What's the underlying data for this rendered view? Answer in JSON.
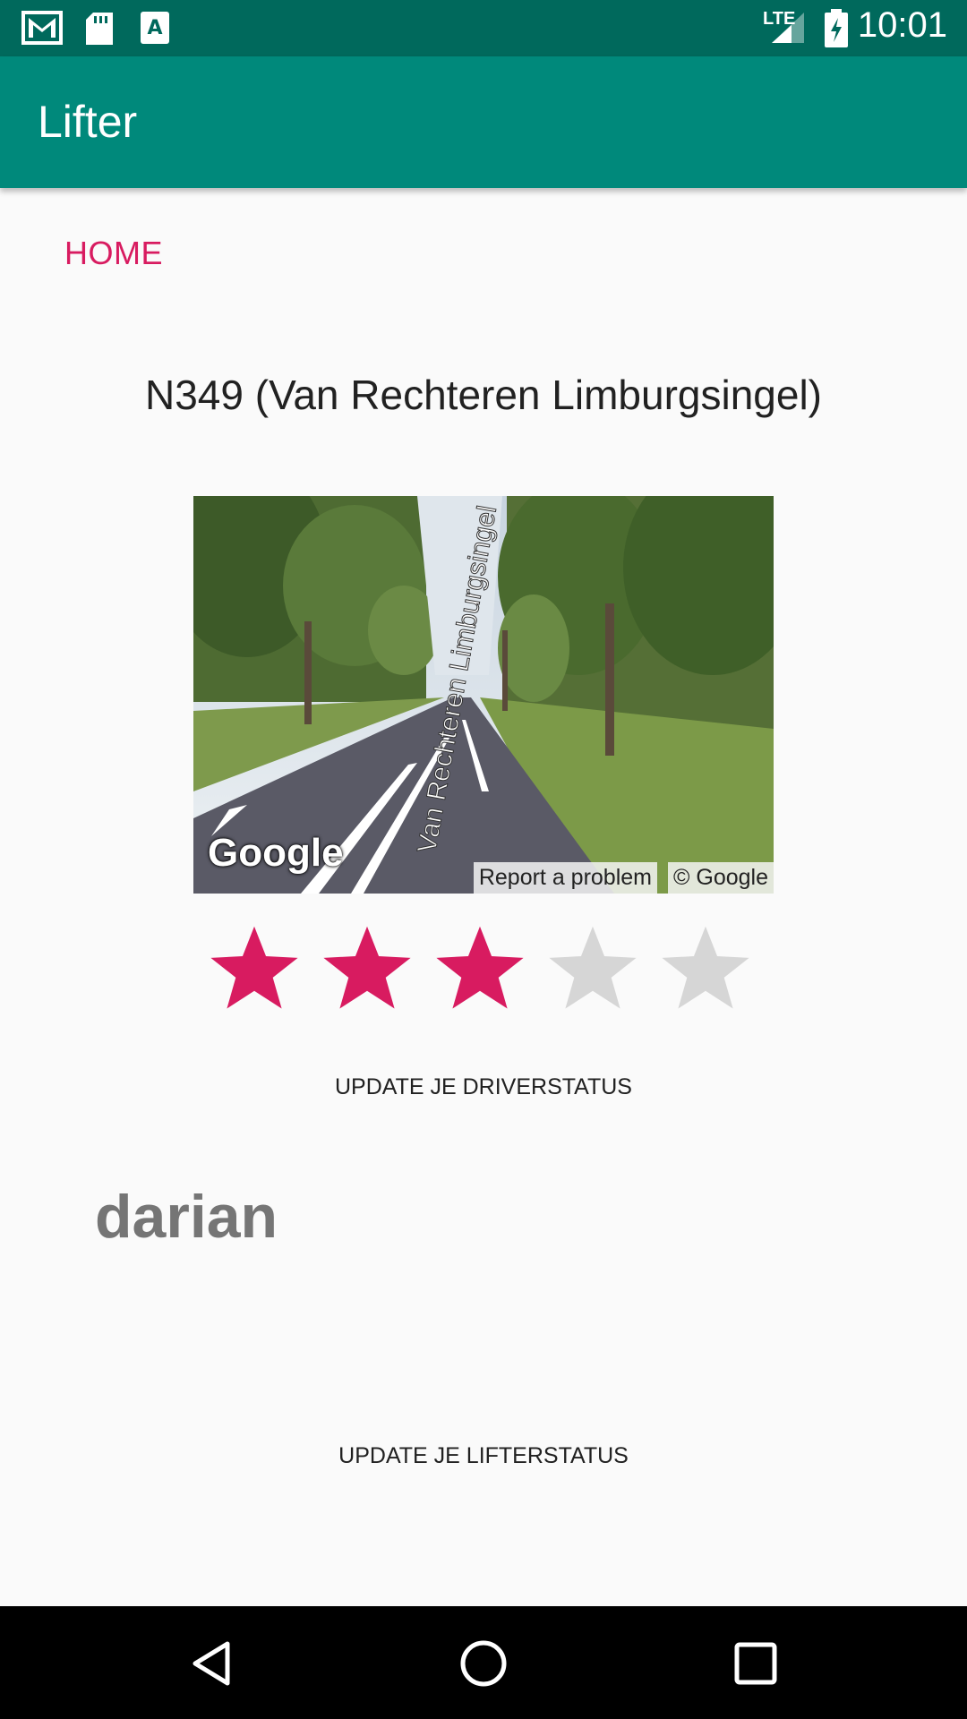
{
  "status_bar": {
    "time": "10:01",
    "network": "LTE",
    "icons": [
      "gmail-icon",
      "sd-card-icon",
      "font-icon",
      "signal-icon",
      "battery-icon"
    ]
  },
  "app_bar": {
    "title": "Lifter"
  },
  "home_button": {
    "label": "HOME"
  },
  "place": {
    "title": "N349 (Van Rechteren Limburgsingel)"
  },
  "street_view": {
    "logo": "Google",
    "report_label": "Report a problem",
    "copyright": "© Google",
    "road_label": "Van Rechteren Limburgsingel"
  },
  "rating": {
    "value": 3,
    "max": 5,
    "active_color": "#d81b60",
    "inactive_color": "#d6d6d6"
  },
  "driver_status_button": {
    "label": "UPDATE JE DRIVERSTATUS"
  },
  "user": {
    "name": "darian"
  },
  "lifter_status_button": {
    "label": "UPDATE JE LIFTERSTATUS"
  },
  "colors": {
    "status_bar": "#00695c",
    "app_bar": "#00897b",
    "accent": "#d81b60"
  },
  "nav_bar": {
    "icons": [
      "back-icon",
      "home-icon",
      "recents-icon"
    ]
  }
}
